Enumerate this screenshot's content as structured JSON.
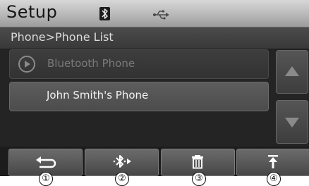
{
  "header": {
    "title": "Setup",
    "icons": [
      "bluetooth-icon",
      "usb-icon"
    ]
  },
  "breadcrumb": {
    "text": "Phone>Phone List"
  },
  "list": {
    "items": [
      {
        "label": "Bluetooth Phone",
        "icon": "play-circle-icon",
        "state": "disabled"
      },
      {
        "label": "John Smith's Phone",
        "state": "normal"
      }
    ]
  },
  "scroll": {
    "up": "arrow-up",
    "down": "arrow-down"
  },
  "softkeys": [
    {
      "icon": "back-icon",
      "callout": "①"
    },
    {
      "icon": "bluetooth-connect-icon",
      "callout": "②"
    },
    {
      "icon": "delete-icon",
      "callout": "③"
    },
    {
      "icon": "move-to-top-icon",
      "callout": "④"
    }
  ],
  "colors": {
    "screen_bg": "#242424",
    "header_bg": "#c4c4c4",
    "button_bg": "#5a5a5a",
    "text_light": "#f2f2f2",
    "text_dim": "#7b7b7b"
  }
}
